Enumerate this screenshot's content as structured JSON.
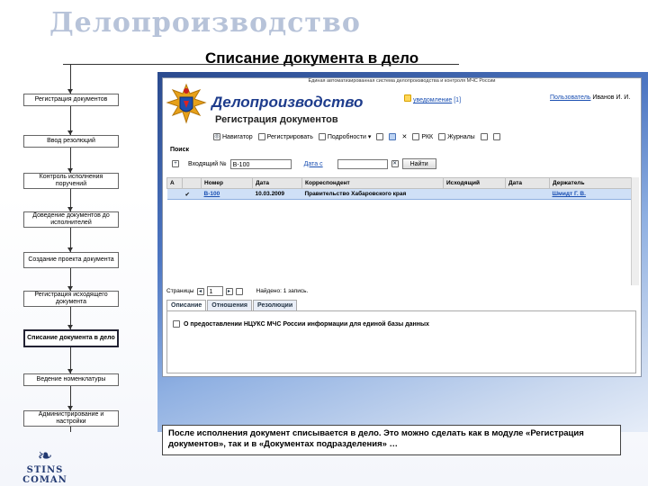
{
  "slide": {
    "title": "Делопроизводство",
    "subtitle": "Списание документа в дело",
    "note": "После исполнения документ списывается в дело. Это можно сделать как в модуле «Регистрация документов», так и в «Документах подразделения» …",
    "logo_text": "STINS COMAN"
  },
  "steps": [
    {
      "label": "Регистрация документов",
      "active": false
    },
    {
      "label": "Ввод резолюций",
      "active": false
    },
    {
      "label": "Контроль исполнения поручений",
      "active": false
    },
    {
      "label": "Доведение документов до исполнителей",
      "active": false
    },
    {
      "label": "Создание проекта документа",
      "active": false
    },
    {
      "label": "Регистрация исходящего документа",
      "active": false
    },
    {
      "label": "Списание документа в дело",
      "active": true
    },
    {
      "label": "Ведение номенклатуры",
      "active": false
    },
    {
      "label": "Администрирование и настройки",
      "active": false
    }
  ],
  "app": {
    "system_name": "Единая автоматизированная система делопроизводства и контроля МЧС России",
    "brand": "Делопроизводство",
    "module": "Регистрация документов",
    "notification_label": "уведомление",
    "notification_count": "[1]",
    "user_label": "Пользователь",
    "user_name": "Иванов И. И.",
    "toolbar": {
      "navigator": "Навигатор",
      "register": "Регистрировать",
      "details": "Подробности",
      "rkk": "РКК",
      "journals": "Журналы"
    },
    "search": {
      "title": "Поиск",
      "incoming_label": "Входящий №",
      "incoming_value": "В-100",
      "date_label": "Дата с",
      "date_value": "",
      "find_button": "Найти"
    },
    "columns": [
      "А",
      "Номер",
      "Дата",
      "Корреспондент",
      "Исходящий",
      "Дата",
      "Держатель"
    ],
    "rows": [
      {
        "number": "В-100",
        "date": "10.03.2009",
        "correspondent": "Правительство Хабаровского края",
        "outgoing": "",
        "out_date": "",
        "holder": "Шмидт Г. В."
      }
    ],
    "pager": {
      "label": "Страницы",
      "page": "1",
      "found": "Найдено: 1 запись."
    },
    "tabs": [
      "Описание",
      "Отношения",
      "Резолюции"
    ],
    "description": "О предоставлении НЦУКС МЧС России информации для единой базы данных"
  },
  "colors": {
    "brand_blue": "#1e3c8c",
    "selection": "#cfe0f7",
    "title_grey": "#b7c3d9"
  }
}
